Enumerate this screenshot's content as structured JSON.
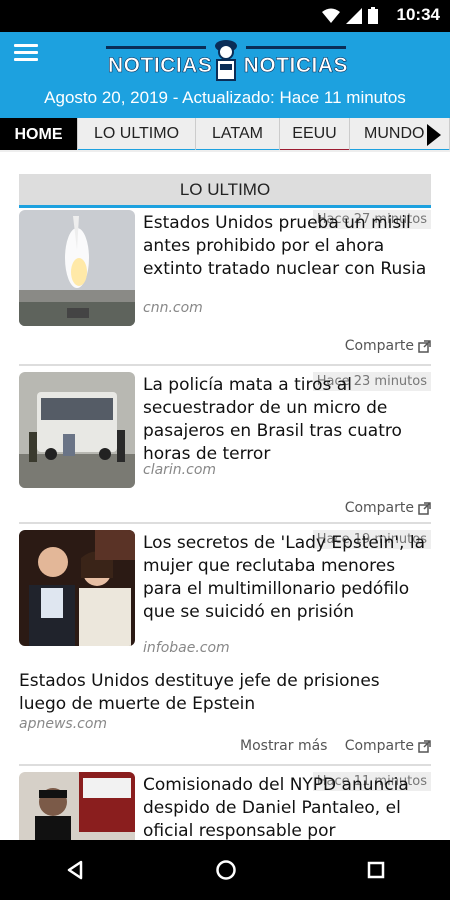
{
  "status_bar": {
    "time": "10:34"
  },
  "header": {
    "logo_left": "NOTICIAS",
    "logo_right": "NOTICIAS",
    "subtitle": "Agosto 20, 2019 - Actualizado: Hace 11 minutos",
    "accent": "#1da1df"
  },
  "tabs": [
    {
      "label": "HOME",
      "active": true,
      "underline": "#000000"
    },
    {
      "label": "LO ULTIMO",
      "active": false,
      "underline": "#1da1df"
    },
    {
      "label": "LATAM",
      "active": false,
      "underline": "#1da1df"
    },
    {
      "label": "EEUU",
      "active": false,
      "underline": "#9b1b30"
    },
    {
      "label": "MUNDO",
      "active": false,
      "underline": "#1da1df"
    }
  ],
  "section": {
    "title": "LO ULTIMO"
  },
  "stories": [
    {
      "headline": "Estados Unidos prueba un misil antes prohibido por el ahora extinto tratado nuclear con Rusia",
      "time": "Hace 27 minutos",
      "source": "cnn.com",
      "share_label": "Comparte",
      "thumb": "missile-launch"
    },
    {
      "headline": "La policía mata a tiros al secuestrador de un micro de pasajeros en Brasil tras cuatro horas de terror",
      "time": "Hace 23 minutos",
      "source": "clarin.com",
      "share_label": "Comparte",
      "thumb": "bus-police"
    },
    {
      "headline": "Los secretos de 'Lady Epstein', la mujer que reclutaba menores para el multimillonario pedófilo que se suicidó en prisión",
      "time": "Hace 19 minutos",
      "source": "infobae.com",
      "share_label": "Comparte",
      "more_label": "Mostrar más",
      "related": {
        "headline": "Estados Unidos destituye jefe de prisiones luego de muerte de Epstein",
        "source": "apnews.com"
      },
      "thumb": "couple-photo"
    },
    {
      "headline": "Comisionado del NYPD anuncia despido de Daniel Pantaleo, el oficial responsable por",
      "time": "Hace 11 minutos",
      "thumb": "protest-photo"
    }
  ]
}
